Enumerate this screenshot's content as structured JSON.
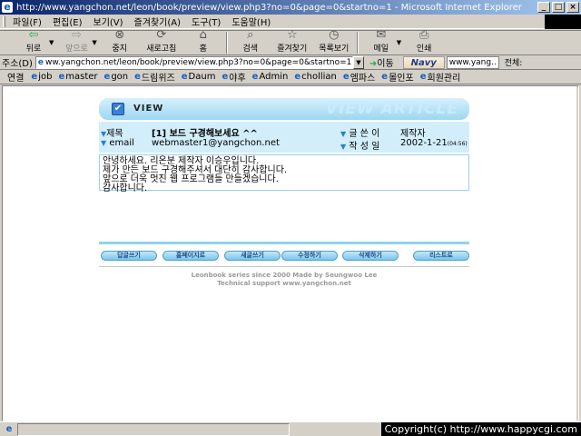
{
  "window": {
    "title": "http://www.yangchon.net/leon/book/preview/view.php3?no=0&page=0&startno=1 - Microsoft Internet Explorer",
    "min": "_",
    "max": "□",
    "close": "×"
  },
  "menu": [
    "파일(F)",
    "편집(E)",
    "보기(V)",
    "즐겨찾기(A)",
    "도구(T)",
    "도움말(H)"
  ],
  "toolbar": {
    "back": "뒤로",
    "forward": "앞으로",
    "stop": "중지",
    "refresh": "새로고침",
    "home": "홈",
    "search": "검색",
    "favorites": "즐겨찾기",
    "history": "목록보기",
    "mail": "메일",
    "print": "인쇄"
  },
  "address": {
    "label": "주소(D)",
    "url": "ww.yangchon.net/leon/book/preview/view.php3?no=0&page=0&startno=1",
    "go": "이동",
    "navy_logo": "Navy",
    "navy_text": "www.yang..",
    "navy_all": "전체:"
  },
  "links": {
    "label": "연결",
    "items": [
      "job",
      "master",
      "gon",
      "드림위즈",
      "Daum",
      "야후",
      "Admin",
      "chollian",
      "엠파스",
      "몰인포",
      "회원관리"
    ]
  },
  "board": {
    "header_label": "VIEW",
    "header_watermark": "VIEW ARTICLE",
    "subject_label": "제목",
    "subject": "[1] 보드 구경해보세요 ^^",
    "email_label": "email",
    "email": "webmaster1@yangchon.net",
    "author_label": "글 쓴 이",
    "author": "제작자",
    "date_label": "작 성 일",
    "date": "2002-1-21",
    "time": "(04:56)",
    "body": [
      "안녕하세요. 리온분 제작자 이승우입니다.",
      "제가 만든 보드 구경해주셔서 대단히 감사합니다.",
      "앞으로 더욱 멋진 웹 프로그램들 만들겠습니다.",
      "감사합니다."
    ],
    "buttons": {
      "reply": "답글쓰기",
      "homepage": "홈페이지로",
      "write": "새글쓰기",
      "edit": "수정하기",
      "delete": "삭제하기",
      "list": "리스트로"
    },
    "credit_line1": "Leonbook series since 2000 Made by Seungwoo Lee",
    "credit_line2": "Technical support www.yangchon.net"
  },
  "status": {
    "copyright": "Copyright(c) http://www.happycgi.com"
  }
}
